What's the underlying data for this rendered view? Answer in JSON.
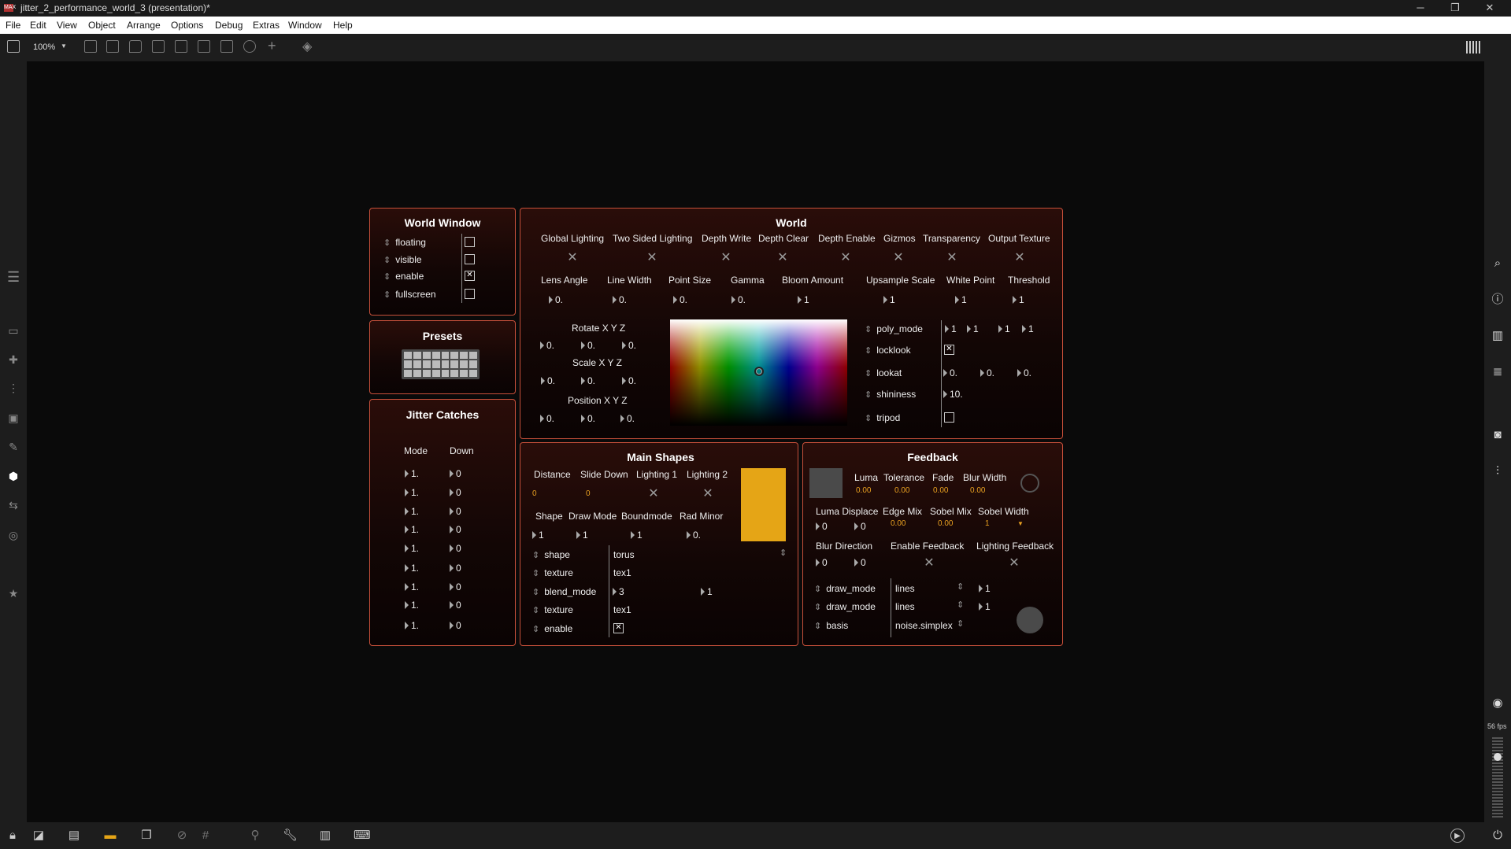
{
  "window": {
    "title": "jitter_2_performance_world_3 (presentation)*",
    "app_badge": "MAX",
    "minimize": "─",
    "maximize": "❐",
    "close": "✕"
  },
  "menu": [
    "File",
    "Edit",
    "View",
    "Object",
    "Arrange",
    "Options",
    "Debug",
    "Extras",
    "Window",
    "Help"
  ],
  "toolbar": {
    "zoom": "100%"
  },
  "fps": "56 fps",
  "world_window": {
    "title": "World Window",
    "items": [
      {
        "label": "floating",
        "checked": false
      },
      {
        "label": "visible",
        "checked": false
      },
      {
        "label": "enable",
        "checked": true
      },
      {
        "label": "fullscreen",
        "checked": false
      }
    ]
  },
  "presets": {
    "title": "Presets"
  },
  "jitter_catches": {
    "title": "Jitter Catches",
    "col_mode": "Mode",
    "col_down": "Down",
    "rows": [
      [
        "1.",
        "0"
      ],
      [
        "1.",
        "0"
      ],
      [
        "1.",
        "0"
      ],
      [
        "1.",
        "0"
      ],
      [
        "1.",
        "0"
      ],
      [
        "1.",
        "0"
      ],
      [
        "1.",
        "0"
      ],
      [
        "1.",
        "0"
      ],
      [
        "1.",
        "0"
      ]
    ]
  },
  "world": {
    "title": "World",
    "toggles": [
      "Global Lighting",
      "Two Sided Lighting",
      "Depth Write",
      "Depth Clear",
      "Depth Enable",
      "Gizmos",
      "Transparency",
      "Output Texture"
    ],
    "params": [
      {
        "label": "Lens Angle",
        "value": "0."
      },
      {
        "label": "Line Width",
        "value": "0."
      },
      {
        "label": "Point Size",
        "value": "0."
      },
      {
        "label": "Gamma",
        "value": "0."
      },
      {
        "label": "Bloom Amount",
        "value": "1"
      },
      {
        "label": "Upsample Scale",
        "value": "1"
      },
      {
        "label": "White Point",
        "value": "1"
      },
      {
        "label": "Threshold",
        "value": "1"
      }
    ],
    "rotate": {
      "label": "Rotate X Y Z",
      "values": [
        "0.",
        "0.",
        "0."
      ]
    },
    "scale": {
      "label": "Scale X Y Z",
      "values": [
        "0.",
        "0.",
        "0."
      ]
    },
    "position": {
      "label": "Position X Y Z",
      "values": [
        "0.",
        "0.",
        "0."
      ]
    },
    "camera": {
      "poly_mode": {
        "label": "poly_mode",
        "values": [
          "1",
          "1",
          "1",
          "1"
        ]
      },
      "locklook": {
        "label": "locklook",
        "checked": true
      },
      "lookat": {
        "label": "lookat",
        "values": [
          "0.",
          "0.",
          "0."
        ]
      },
      "shininess": {
        "label": "shininess",
        "value": "10."
      },
      "tripod": {
        "label": "tripod",
        "checked": false
      }
    }
  },
  "main_shapes": {
    "title": "Main Shapes",
    "distance": {
      "label": "Distance",
      "value": "0"
    },
    "slide_down": {
      "label": "Slide Down",
      "value": "0"
    },
    "lighting1": "Lighting 1",
    "lighting2": "Lighting 2",
    "shape_lbl": "Shape",
    "shape_val": "1",
    "draw_mode_lbl": "Draw Mode",
    "draw_mode_val": "1",
    "boundmode_lbl": "Boundmode",
    "boundmode_val": "1",
    "rad_minor_lbl": "Rad Minor",
    "rad_minor_val": "0.",
    "attrs": [
      {
        "label": "shape",
        "value": "torus"
      },
      {
        "label": "texture",
        "value": "tex1"
      },
      {
        "label": "blend_mode",
        "value": "3",
        "extra": "1"
      },
      {
        "label": "texture",
        "value": "tex1"
      },
      {
        "label": "enable",
        "value": "☒"
      }
    ],
    "swatch_color": "#e5a516"
  },
  "feedback": {
    "title": "Feedback",
    "luma": {
      "label": "Luma",
      "value": "0.00"
    },
    "tolerance": {
      "label": "Tolerance",
      "value": "0.00"
    },
    "fade": {
      "label": "Fade",
      "value": "0.00"
    },
    "blur_width": {
      "label": "Blur Width",
      "value": "0.00"
    },
    "luma_displace": {
      "label": "Luma Displace",
      "values": [
        "0",
        "0"
      ]
    },
    "edge_mix": {
      "label": "Edge Mix",
      "value": "0.00"
    },
    "sobel_mix": {
      "label": "Sobel Mix",
      "value": "0.00"
    },
    "sobel_width": {
      "label": "Sobel Width",
      "value": "1"
    },
    "blur_direction": {
      "label": "Blur Direction",
      "values": [
        "0",
        "0"
      ]
    },
    "enable_feedback": "Enable Feedback",
    "lighting_feedback": "Lighting Feedback",
    "attrs": [
      {
        "label": "draw_mode",
        "value": "lines",
        "extra": "1"
      },
      {
        "label": "draw_mode",
        "value": "lines",
        "extra": "1"
      },
      {
        "label": "basis",
        "value": "noise.simplex",
        "extra": ""
      }
    ]
  },
  "colors": {
    "accent": "#c8503a",
    "orange": "#e5a516",
    "label_orange": "#e8a020"
  }
}
